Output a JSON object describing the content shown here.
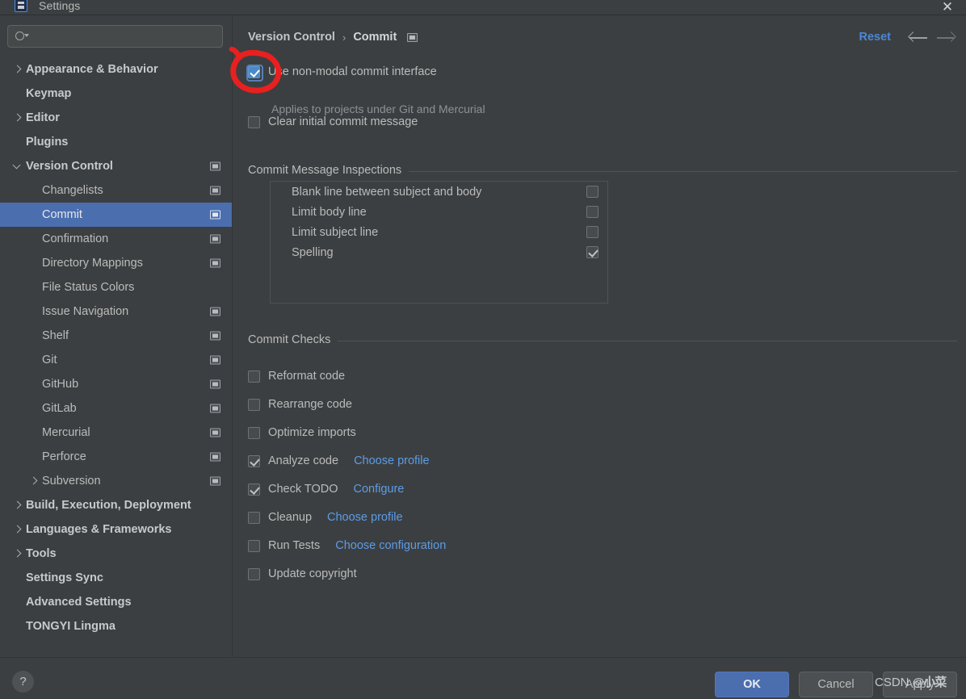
{
  "window": {
    "title": "Settings",
    "app_icon": "ide-settings-icon",
    "close_icon": "✕"
  },
  "sidebar": {
    "search": {
      "placeholder": "",
      "value": "",
      "icon": "search-icon"
    },
    "items": [
      {
        "label": "Appearance & Behavior",
        "level": 0,
        "arrow": "right",
        "group": true,
        "project_icon": false,
        "selected": false
      },
      {
        "label": "Keymap",
        "level": 0,
        "arrow": "none",
        "group": true,
        "project_icon": false,
        "selected": false
      },
      {
        "label": "Editor",
        "level": 0,
        "arrow": "right",
        "group": true,
        "project_icon": false,
        "selected": false
      },
      {
        "label": "Plugins",
        "level": 0,
        "arrow": "none",
        "group": true,
        "project_icon": false,
        "selected": false
      },
      {
        "label": "Version Control",
        "level": 0,
        "arrow": "down",
        "group": true,
        "project_icon": true,
        "selected": false
      },
      {
        "label": "Changelists",
        "level": 1,
        "arrow": "none",
        "group": false,
        "project_icon": true,
        "selected": false
      },
      {
        "label": "Commit",
        "level": 1,
        "arrow": "none",
        "group": false,
        "project_icon": true,
        "selected": true
      },
      {
        "label": "Confirmation",
        "level": 1,
        "arrow": "none",
        "group": false,
        "project_icon": true,
        "selected": false
      },
      {
        "label": "Directory Mappings",
        "level": 1,
        "arrow": "none",
        "group": false,
        "project_icon": true,
        "selected": false
      },
      {
        "label": "File Status Colors",
        "level": 1,
        "arrow": "none",
        "group": false,
        "project_icon": false,
        "selected": false
      },
      {
        "label": "Issue Navigation",
        "level": 1,
        "arrow": "none",
        "group": false,
        "project_icon": true,
        "selected": false
      },
      {
        "label": "Shelf",
        "level": 1,
        "arrow": "none",
        "group": false,
        "project_icon": true,
        "selected": false
      },
      {
        "label": "Git",
        "level": 1,
        "arrow": "none",
        "group": false,
        "project_icon": true,
        "selected": false
      },
      {
        "label": "GitHub",
        "level": 1,
        "arrow": "none",
        "group": false,
        "project_icon": true,
        "selected": false
      },
      {
        "label": "GitLab",
        "level": 1,
        "arrow": "none",
        "group": false,
        "project_icon": true,
        "selected": false
      },
      {
        "label": "Mercurial",
        "level": 1,
        "arrow": "none",
        "group": false,
        "project_icon": true,
        "selected": false
      },
      {
        "label": "Perforce",
        "level": 1,
        "arrow": "none",
        "group": false,
        "project_icon": true,
        "selected": false
      },
      {
        "label": "Subversion",
        "level": 1,
        "arrow": "right",
        "group": false,
        "project_icon": true,
        "selected": false
      },
      {
        "label": "Build, Execution, Deployment",
        "level": 0,
        "arrow": "right",
        "group": true,
        "project_icon": false,
        "selected": false
      },
      {
        "label": "Languages & Frameworks",
        "level": 0,
        "arrow": "right",
        "group": true,
        "project_icon": false,
        "selected": false
      },
      {
        "label": "Tools",
        "level": 0,
        "arrow": "right",
        "group": true,
        "project_icon": false,
        "selected": false
      },
      {
        "label": "Settings Sync",
        "level": 0,
        "arrow": "none",
        "group": true,
        "project_icon": false,
        "selected": false
      },
      {
        "label": "Advanced Settings",
        "level": 0,
        "arrow": "none",
        "group": true,
        "project_icon": false,
        "selected": false
      },
      {
        "label": "TONGYI Lingma",
        "level": 0,
        "arrow": "none",
        "group": true,
        "project_icon": false,
        "selected": false
      }
    ]
  },
  "header": {
    "breadcrumb_parent": "Version Control",
    "breadcrumb_separator": "›",
    "breadcrumb_current": "Commit",
    "breadcrumb_icon": "project-level-settings-icon",
    "reset_label": "Reset",
    "back_icon": "arrow-left-icon",
    "forward_icon": "arrow-right-icon"
  },
  "main": {
    "top_options": [
      {
        "label": "Use non-modal commit interface",
        "checked": true,
        "mnemonic": "U",
        "style": "blue"
      },
      {
        "label": "Clear initial commit message",
        "checked": false,
        "mnemonic": "i",
        "style": "normal"
      }
    ],
    "top_note": "Applies to projects under Git and Mercurial",
    "inspections": {
      "title": "Commit Message Inspections",
      "rows": [
        {
          "label": "Blank line between subject and body",
          "checked": false
        },
        {
          "label": "Limit body line",
          "checked": false
        },
        {
          "label": "Limit subject line",
          "checked": false
        },
        {
          "label": "Spelling",
          "checked": true
        }
      ]
    },
    "checks": {
      "title": "Commit Checks",
      "rows": [
        {
          "label": "Reformat code",
          "checked": false,
          "mnemonic": "R",
          "link": ""
        },
        {
          "label": "Rearrange code",
          "checked": false,
          "mnemonic": "n",
          "link": ""
        },
        {
          "label": "Optimize imports",
          "checked": false,
          "mnemonic": "O",
          "link": ""
        },
        {
          "label": "Analyze code",
          "checked": true,
          "mnemonic": "A",
          "link": "Choose profile"
        },
        {
          "label": "Check TODO",
          "checked": true,
          "mnemonic": "",
          "link": "Configure"
        },
        {
          "label": "Cleanup",
          "checked": false,
          "mnemonic": "l",
          "link": "Choose profile"
        },
        {
          "label": "Run Tests",
          "checked": false,
          "mnemonic": "",
          "link": "Choose configuration"
        },
        {
          "label": "Update copyright",
          "checked": false,
          "mnemonic": "",
          "link": ""
        }
      ]
    }
  },
  "footer": {
    "help_label": "?",
    "ok_label": "OK",
    "cancel_label": "Cancel",
    "apply_label": "Apply"
  },
  "watermark": {
    "prefix": "CSDN ",
    "handle": "@小菜"
  },
  "annotation": {
    "shape": "red-circle-highlight",
    "color": "#e8201f",
    "target": "use-non-modal-commit-interface-checkbox"
  },
  "colors": {
    "background": "#3c3f41",
    "selection": "#4b6eaf",
    "link": "#5c9ce6",
    "text": "#bbbbbb",
    "accent_checkbox": "#4a88c7"
  }
}
